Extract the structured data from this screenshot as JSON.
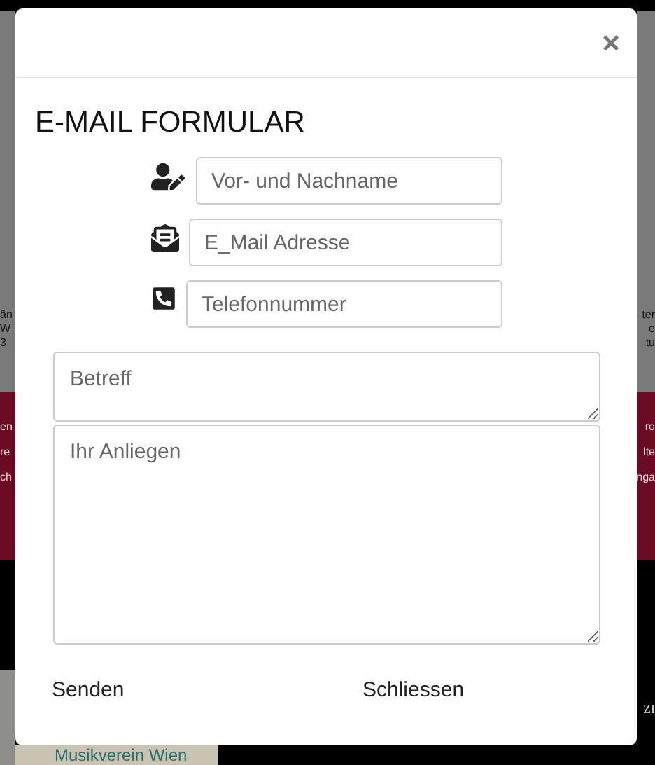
{
  "background": {
    "left_fragments": [
      {
        "text": "än",
        "kind": "dark"
      },
      {
        "text": "W",
        "kind": "dark"
      },
      {
        "text": "3",
        "kind": "dark"
      },
      {
        "text": "en",
        "kind": "light"
      },
      {
        "text": "re",
        "kind": "light"
      },
      {
        "text": "ch",
        "kind": "light"
      }
    ],
    "right_fragments": [
      {
        "text": "ter",
        "kind": "dark"
      },
      {
        "text": "e",
        "kind": "dark"
      },
      {
        "text": "tu",
        "kind": "dark"
      },
      {
        "text": "ro",
        "kind": "light"
      },
      {
        "text": "lte",
        "kind": "light"
      },
      {
        "text": "nga",
        "kind": "light"
      }
    ],
    "right_bottom": "ZI",
    "map_label": "Musikverein Wien"
  },
  "dialog": {
    "close": "×",
    "title": "E-MAIL FORMULAR",
    "fields": [
      {
        "kind": "person",
        "placeholder": "Vor- und Nachname"
      },
      {
        "kind": "email",
        "placeholder": "E_Mail Adresse"
      },
      {
        "kind": "phone",
        "placeholder": "Telefonnummer"
      }
    ],
    "subject": {
      "placeholder": "Betreff"
    },
    "message": {
      "placeholder": "Ihr Anliegen"
    },
    "buttons": [
      "Senden",
      "Schliessen"
    ]
  }
}
